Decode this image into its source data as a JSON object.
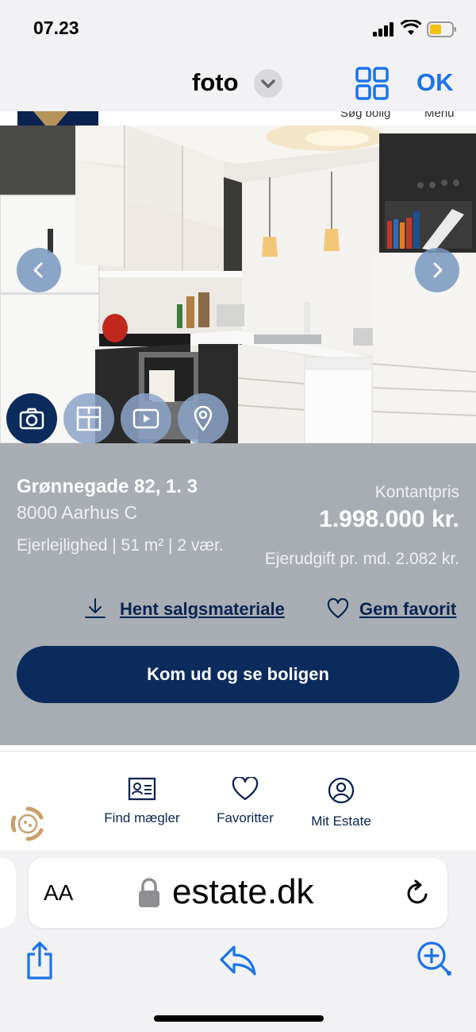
{
  "status": {
    "time": "07.23"
  },
  "topnav": {
    "title": "foto",
    "ok_label": "OK"
  },
  "webhead": {
    "search_label": "Søg bolig",
    "menu_label": "Menu"
  },
  "property": {
    "address": "Grønnegade 82, 1. 3",
    "city": "8000 Aarhus C",
    "specs": "Ejerlejlighed   |   51 m² | 2 vær.",
    "price_label": "Kontantpris",
    "price": "1.998.000 kr.",
    "fee": "Ejerudgift pr. md. 2.082 kr."
  },
  "actions": {
    "download_label": "Hent salgsmateriale",
    "favorite_label": "Gem favorit",
    "cta_label": "Kom ud og se boligen"
  },
  "media_buttons": [
    "camera-icon",
    "floorplan-icon",
    "video-icon",
    "location-pin-icon"
  ],
  "sitenav": {
    "items": [
      {
        "label": "Find mægler",
        "icon": "id-card-icon"
      },
      {
        "label": "Favoritter",
        "icon": "heart-icon"
      },
      {
        "label": "Mit Estate",
        "icon": "user-icon"
      }
    ]
  },
  "browser": {
    "aa_label": "AA",
    "domain": "estate.dk"
  },
  "colors": {
    "brand_navy": "#0b2b5c",
    "panel_gray": "#a8adb3",
    "ios_blue": "#1a73e8",
    "gold": "#b5935a"
  }
}
